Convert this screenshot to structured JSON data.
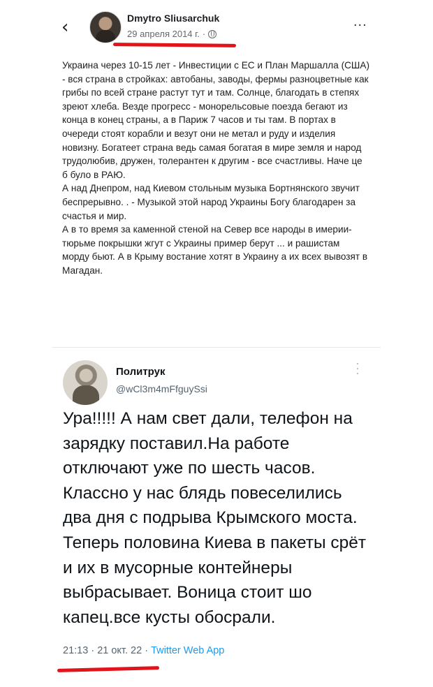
{
  "facebook_post": {
    "back_icon": "chevron-left-icon",
    "author": "Dmytro Sliusarchuk",
    "date": "29 апреля 2014 г.",
    "separator": "·",
    "audience_icon": "globe-icon",
    "more_label": "...",
    "paragraphs": [
      "Украина через 10-15 лет - Инвестиции с ЕС и План Маршалла (США) - вся страна в стройках: автобаны, заводы, фермы разноцветные как грибы по всей стране растут тут и там. Солнце, благодать в степях зреют хлеба. Везде прогресс - монорельсовые поезда бегают из конца в конец страны, а в Париж 7 часов и ты там. В портах в очереди стоят корабли и везут они не метал и руду и изделия новизну. Богатеет страна ведь самая богатая в мире земля и народ трудолюбив, дружен, толерантен к другим - все счастливы. Наче це б було в РАЮ.",
      "А над Днепром, над Киевом стольным музыка Бортнянского звучит беспрерывно. . - Музыкой этой народ Украины Богу благодарен за счастья и мир.",
      "А в то время за каменной стеной на Север все народы в имерии-тюрьме покрышки жгут с Украины пример берут ... и рашистам морду бьют. А в Крыму востание хотят в Украину а их всех вывозят в Магадан."
    ],
    "highlight_color": "#e0141a"
  },
  "tweet": {
    "display_name": "Политрук",
    "handle": "@wCl3m4mFfguySsi",
    "text": "Ура!!!!! А нам свет дали, телефон на зарядку поставил.На работе отключают уже по шесть часов. Классно у нас блядь повеселились два дня с подрыва Крымского моста. Теперь половина Киева в пакеты срёт и их в мусорные контейнеры выбрасывает. Воница стоит шо капец.все кусты обосрали.",
    "time": "21:13",
    "date": "21 окт. 22",
    "separator": "·",
    "source": "Twitter Web App",
    "more_icon": "vertical-dots-icon",
    "source_color": "#1d9bf0"
  }
}
